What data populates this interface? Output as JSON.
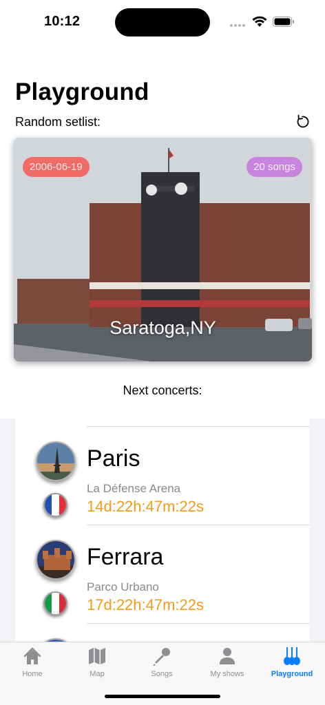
{
  "status_bar": {
    "time": "10:12"
  },
  "header": {
    "title": "Playground",
    "subtitle": "Random setlist:"
  },
  "setlist": {
    "date": "2006-06-19",
    "songs": "20 songs",
    "city": "Saratoga,NY"
  },
  "next_concerts": {
    "title": "Next concerts:",
    "items": [
      {
        "city": "Paris",
        "venue": "La Défense Arena",
        "countdown": "14d:22h:47m:22s",
        "flag": "france"
      },
      {
        "city": "Ferrara",
        "venue": "Parco Urbano",
        "countdown": "17d:22h:47m:22s",
        "flag": "italy"
      }
    ]
  },
  "tabs": [
    {
      "label": "Home",
      "icon": "house-icon",
      "active": false
    },
    {
      "label": "Map",
      "icon": "map-icon",
      "active": false
    },
    {
      "label": "Songs",
      "icon": "microphone-icon",
      "active": false
    },
    {
      "label": "My shows",
      "icon": "person-icon",
      "active": false
    },
    {
      "label": "Playground",
      "icon": "guitars-icon",
      "active": true
    }
  ],
  "colors": {
    "accent": "#0a7cff",
    "countdown": "#f39a17",
    "date_badge": "#f06a66",
    "songs_badge": "#c785dd"
  }
}
